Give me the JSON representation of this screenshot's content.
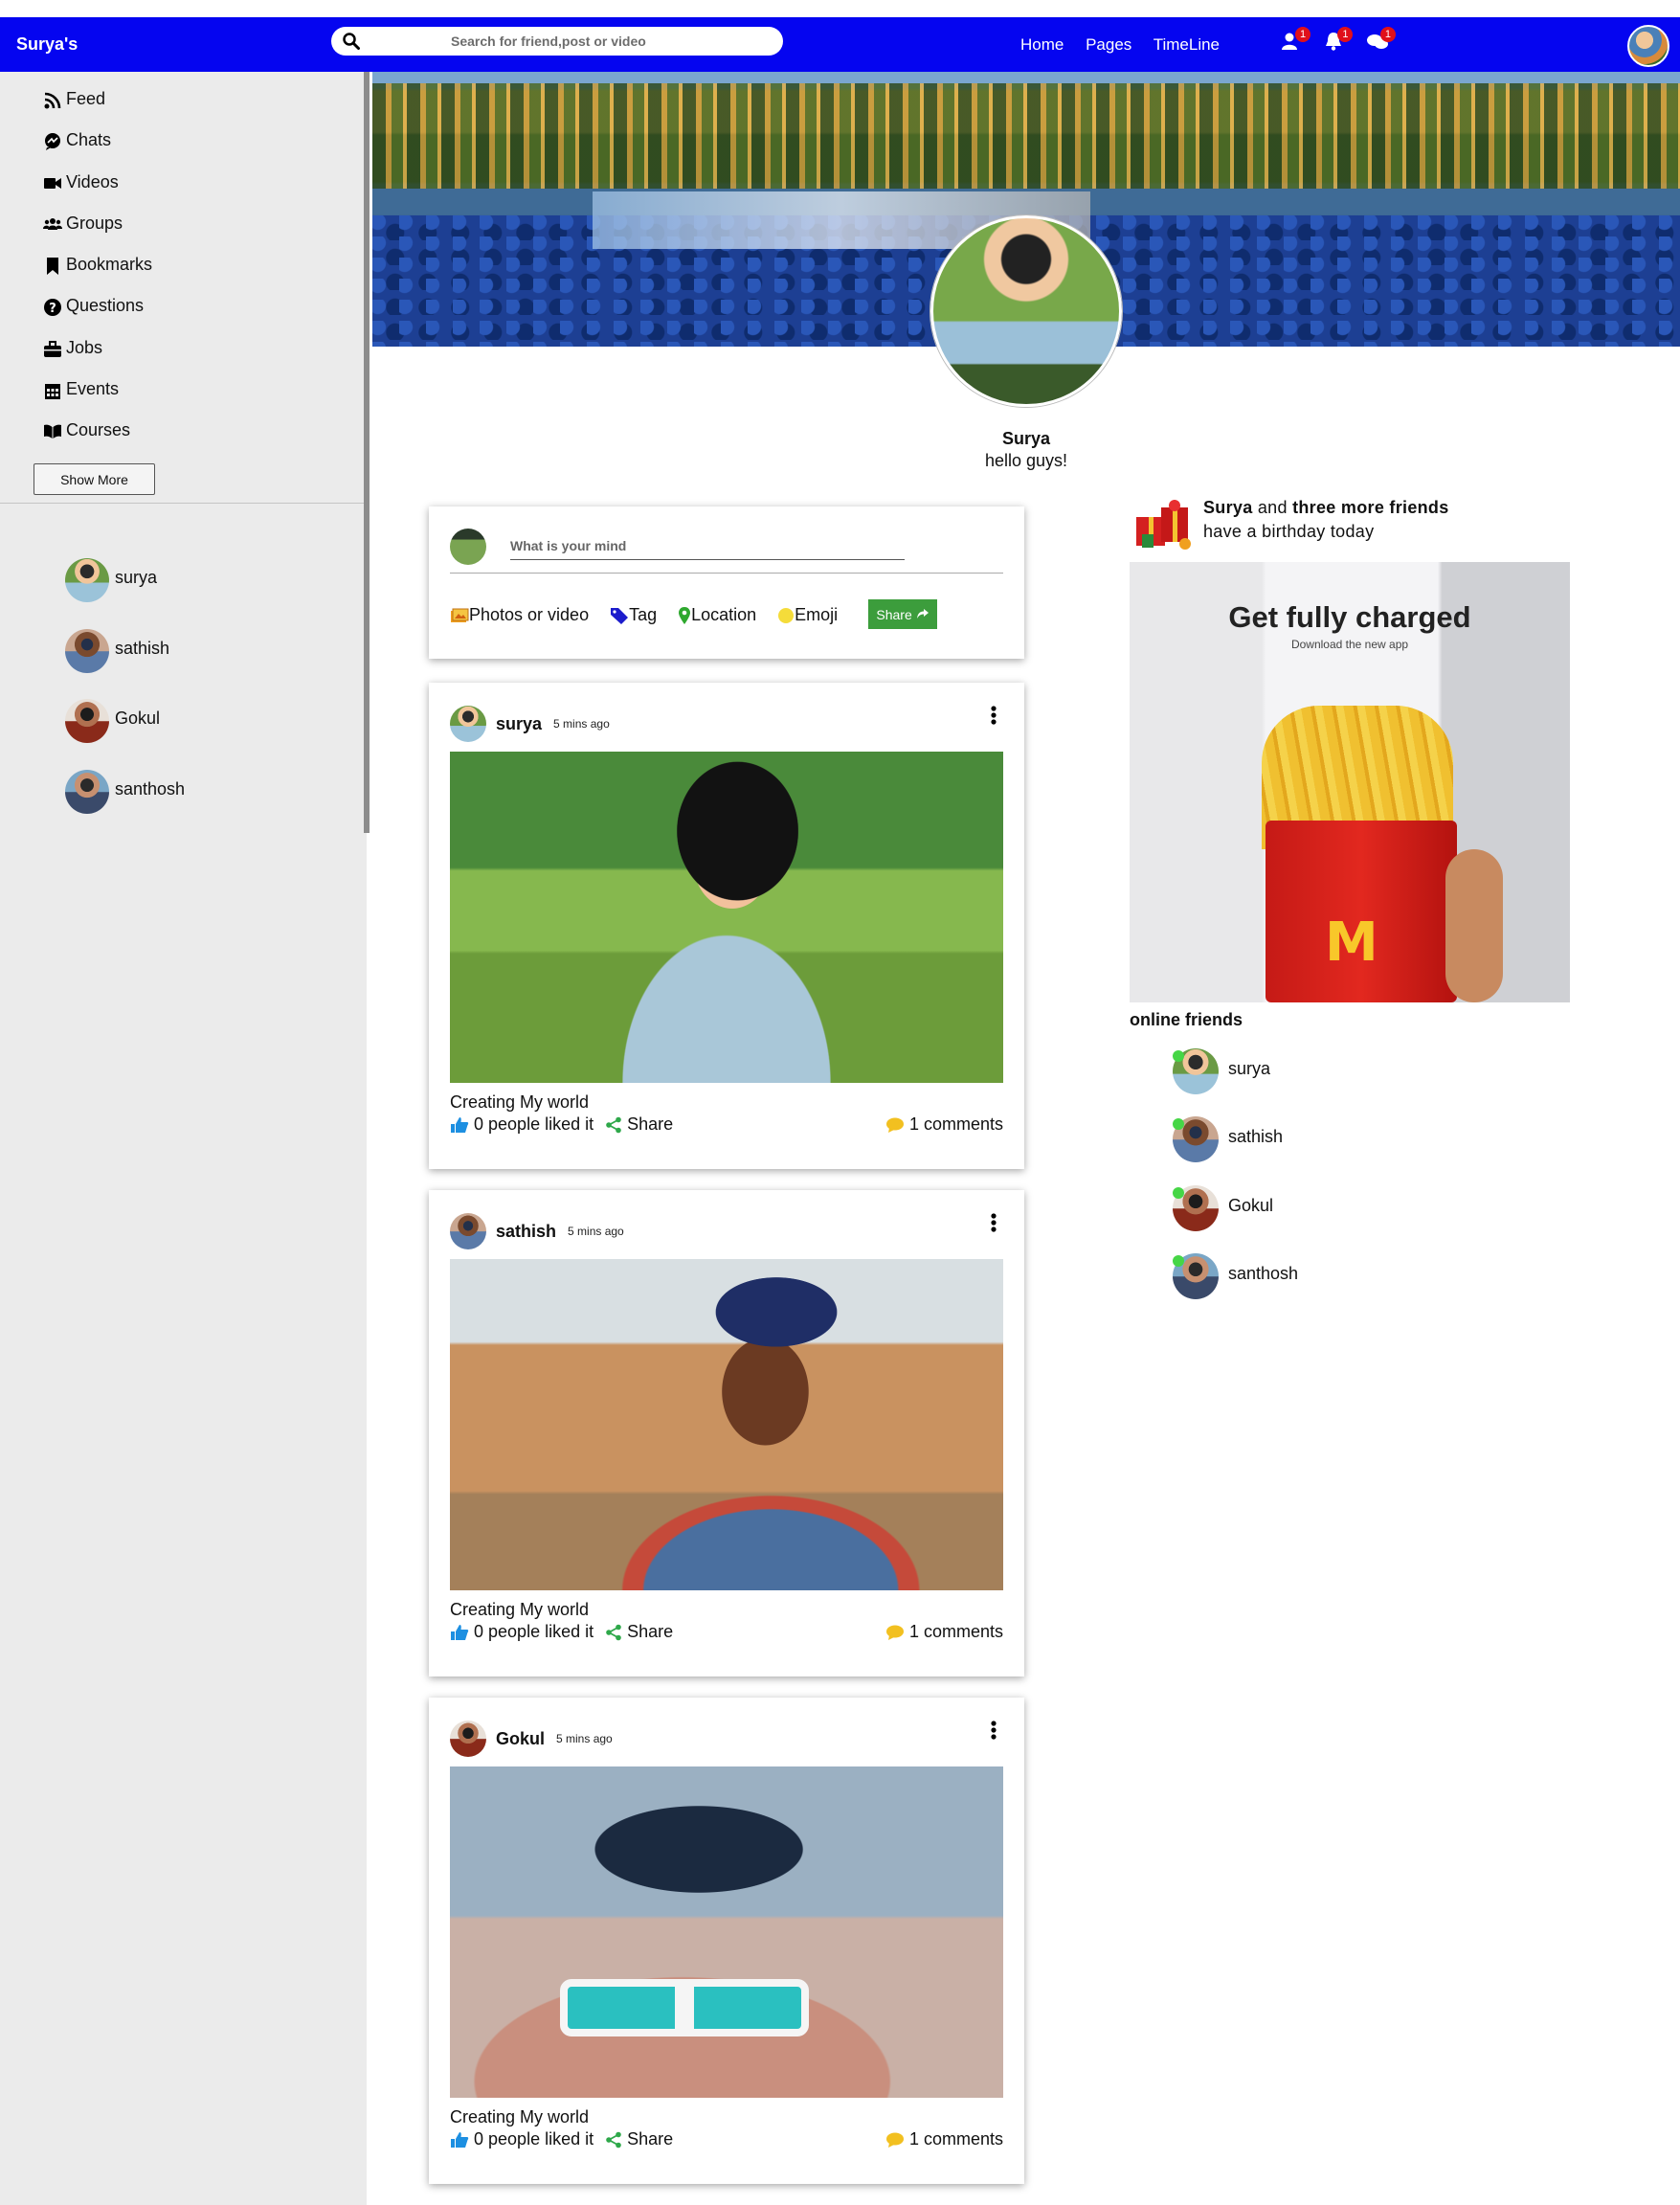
{
  "header": {
    "brand": "Surya's",
    "search_placeholder": "Search for friend,post or video",
    "nav_links": [
      "Home",
      "Pages",
      "TimeLine"
    ],
    "badges": {
      "friends": "1",
      "notifications": "1",
      "messages": "1"
    }
  },
  "sidebar": {
    "menu": [
      {
        "label": "Feed",
        "icon": "rss-icon"
      },
      {
        "label": "Chats",
        "icon": "chat-icon"
      },
      {
        "label": "Videos",
        "icon": "video-icon"
      },
      {
        "label": "Groups",
        "icon": "users-icon"
      },
      {
        "label": "Bookmarks",
        "icon": "bookmark-icon"
      },
      {
        "label": "Questions",
        "icon": "question-icon"
      },
      {
        "label": "Jobs",
        "icon": "briefcase-icon"
      },
      {
        "label": "Events",
        "icon": "calendar-icon"
      },
      {
        "label": "Courses",
        "icon": "book-icon"
      }
    ],
    "show_more": "Show More",
    "friends": [
      "surya",
      "sathish",
      "Gokul",
      "santhosh"
    ]
  },
  "profile": {
    "name": "Surya",
    "description": "hello guys!"
  },
  "share": {
    "placeholder": "What is your mind",
    "options": [
      "Photos or video",
      "Tag",
      "Location",
      "Emoji"
    ],
    "button": "Share"
  },
  "posts": [
    {
      "username": "surya",
      "time": "5 mins ago",
      "caption": "Creating My world",
      "likes": "0 people liked it",
      "share": "Share",
      "comments": "1 comments"
    },
    {
      "username": "sathish",
      "time": "5 mins ago",
      "caption": "Creating My world",
      "likes": "0 people liked it",
      "share": "Share",
      "comments": "1 comments"
    },
    {
      "username": "Gokul",
      "time": "5 mins ago",
      "caption": "Creating My world",
      "likes": "0 people liked it",
      "share": "Share",
      "comments": "1 comments"
    }
  ],
  "birthday": {
    "name": "Surya",
    "and_text": "and",
    "friends_text": "three more friends",
    "line2": "have a birthday today"
  },
  "ad": {
    "title": "Get fully charged",
    "subtitle": "Download the new app",
    "logo_text": "M"
  },
  "online": {
    "title": "online friends",
    "friends": [
      "surya",
      "sathish",
      "Gokul",
      "santhosh"
    ]
  },
  "colors": {
    "navbar": "#0505f0",
    "share_button": "#3c9d3c",
    "online_dot": "#46d646",
    "badge": "#e0101a"
  }
}
